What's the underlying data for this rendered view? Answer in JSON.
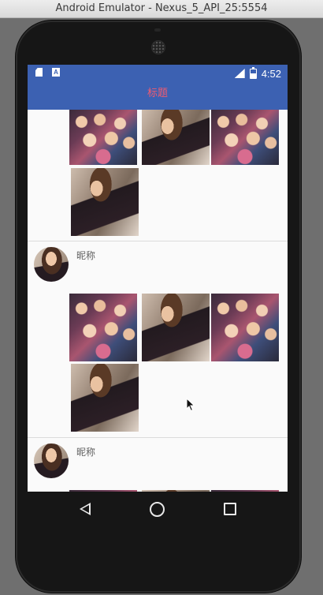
{
  "window": {
    "title": "Android Emulator - Nexus_5_API_25:5554"
  },
  "status_bar": {
    "time": "4:52",
    "network": "4G"
  },
  "toolbar": {
    "title": "标题"
  },
  "posts": [
    {
      "nickname": "",
      "photos": [
        "group-photo",
        "girl-photo",
        "group-photo",
        "girl-photo"
      ]
    },
    {
      "nickname": "昵称",
      "photos": [
        "group-photo",
        "girl-photo",
        "group-photo",
        "girl-photo"
      ]
    },
    {
      "nickname": "昵称",
      "photos": [
        "group-photo",
        "girl-photo",
        "group-photo"
      ]
    }
  ],
  "navigation": {
    "icons": [
      "back-icon",
      "home-icon",
      "recents-icon"
    ]
  },
  "colors": {
    "accent": "#3c61b2",
    "title_text": "#f25b6f",
    "background": "#fafafa"
  }
}
